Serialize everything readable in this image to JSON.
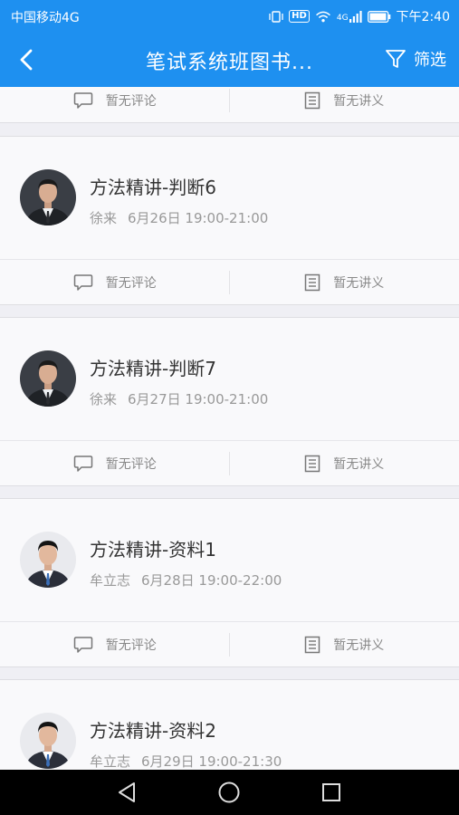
{
  "status_bar": {
    "carrier": "中国移动4G",
    "hd": "HD",
    "network": "4G",
    "time": "下午2:40"
  },
  "nav": {
    "title": "笔试系统班图书...",
    "filter_label": "筛选"
  },
  "actions": {
    "comments": "暂无评论",
    "handouts": "暂无讲义"
  },
  "lessons": [
    {
      "title": "方法精讲-判断6",
      "teacher": "徐来",
      "datetime": "6月26日 19:00-21:00"
    },
    {
      "title": "方法精讲-判断7",
      "teacher": "徐来",
      "datetime": "6月27日 19:00-21:00"
    },
    {
      "title": "方法精讲-资料1",
      "teacher": "牟立志",
      "datetime": "6月28日 19:00-22:00"
    },
    {
      "title": "方法精讲-资料2",
      "teacher": "牟立志",
      "datetime": "6月29日 19:00-21:30"
    }
  ],
  "colors": {
    "primary": "#1e90f0",
    "background": "#efeff4",
    "card": "#f9f9fb",
    "title_text": "#333333",
    "meta_text": "#999999"
  }
}
